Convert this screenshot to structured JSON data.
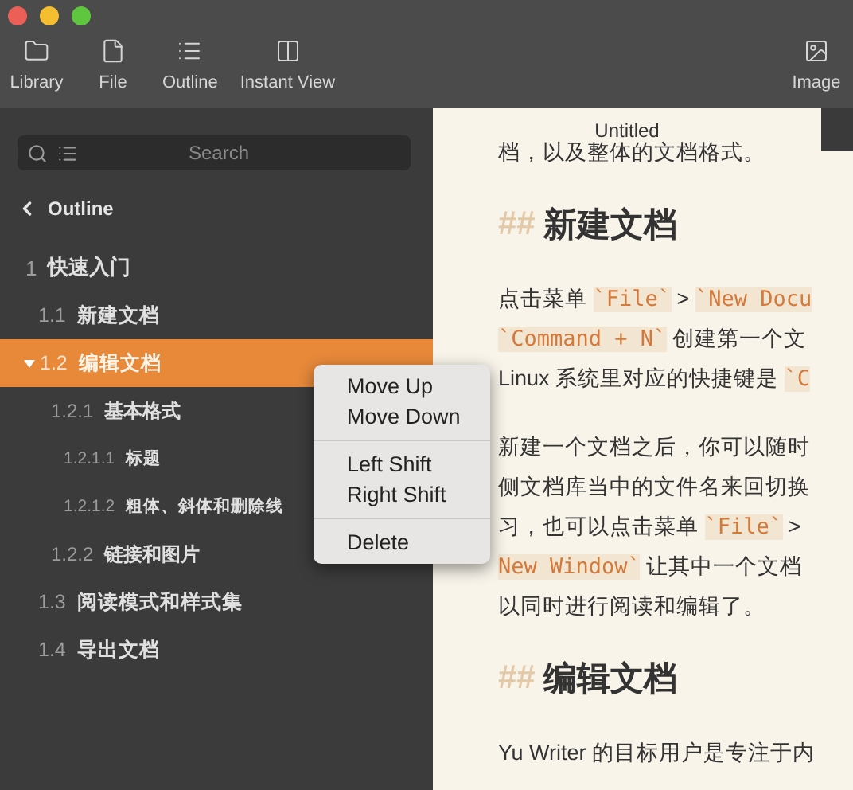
{
  "toolbar": {
    "left": [
      {
        "label": "Library"
      },
      {
        "label": "File"
      },
      {
        "label": "Outline"
      },
      {
        "label": "Instant View"
      }
    ],
    "right": [
      {
        "label": "Image"
      }
    ]
  },
  "sidebar": {
    "search": {
      "placeholder": "Search"
    },
    "back": "Outline",
    "outline": [
      {
        "number": "1",
        "title": "快速入门",
        "selected": false,
        "children": [
          {
            "number": "1.1",
            "title": "新建文档",
            "selected": false
          },
          {
            "number": "1.2",
            "title": "编辑文档",
            "selected": true,
            "children": [
              {
                "number": "1.2.1",
                "title": "基本格式",
                "selected": false,
                "children": [
                  {
                    "number": "1.2.1.1",
                    "title": "标题",
                    "selected": false
                  },
                  {
                    "number": "1.2.1.2",
                    "title": "粗体、斜体和删除线",
                    "selected": false
                  }
                ]
              },
              {
                "number": "1.2.2",
                "title": "链接和图片",
                "selected": false
              }
            ]
          },
          {
            "number": "1.3",
            "title": "阅读模式和样式集",
            "selected": false
          },
          {
            "number": "1.4",
            "title": "导出文档",
            "selected": false
          }
        ]
      }
    ]
  },
  "context_menu": [
    [
      "Move Up",
      "Move Down"
    ],
    [
      "Left Shift",
      "Right Shift"
    ],
    [
      "Delete"
    ]
  ],
  "editor": {
    "tab": "Untitled",
    "blocks": [
      {
        "kind": "paragraph",
        "lines": [
          [
            {
              "text": "档，以及整体的文档格式。",
              "code": false
            }
          ]
        ]
      },
      {
        "kind": "heading",
        "mark": "##",
        "text": "新建文档"
      },
      {
        "kind": "paragraph",
        "lines": [
          [
            {
              "text": "点击菜单 ",
              "code": false
            },
            {
              "text": "`File`",
              "code": true
            },
            {
              "text": " > ",
              "code": false
            },
            {
              "text": "`New Docu",
              "code": true
            }
          ],
          [
            {
              "text": "`Command + N`",
              "code": true
            },
            {
              "text": " 创建第一个文",
              "code": false
            }
          ],
          [
            {
              "text": "Linux 系统里对应的快捷键是 ",
              "code": false
            },
            {
              "text": "`C",
              "code": true
            }
          ]
        ]
      },
      {
        "kind": "paragraph",
        "lines": [
          [
            {
              "text": "新建一个文档之后，你可以随时",
              "code": false
            }
          ],
          [
            {
              "text": "侧文档库当中的文件名来回切换",
              "code": false
            }
          ],
          [
            {
              "text": "习，也可以点击菜单 ",
              "code": false
            },
            {
              "text": "`File`",
              "code": true
            },
            {
              "text": " >",
              "code": false
            }
          ],
          [
            {
              "text": "New Window`",
              "code": true
            },
            {
              "text": " 让其中一个文档",
              "code": false
            }
          ],
          [
            {
              "text": "以同时进行阅读和编辑了。",
              "code": false
            }
          ]
        ]
      },
      {
        "kind": "heading",
        "mark": "##",
        "text": "编辑文档"
      },
      {
        "kind": "paragraph",
        "lines": [
          [
            {
              "text": "Yu Writer 的目标用户是专注于内",
              "code": false
            }
          ]
        ]
      }
    ]
  }
}
